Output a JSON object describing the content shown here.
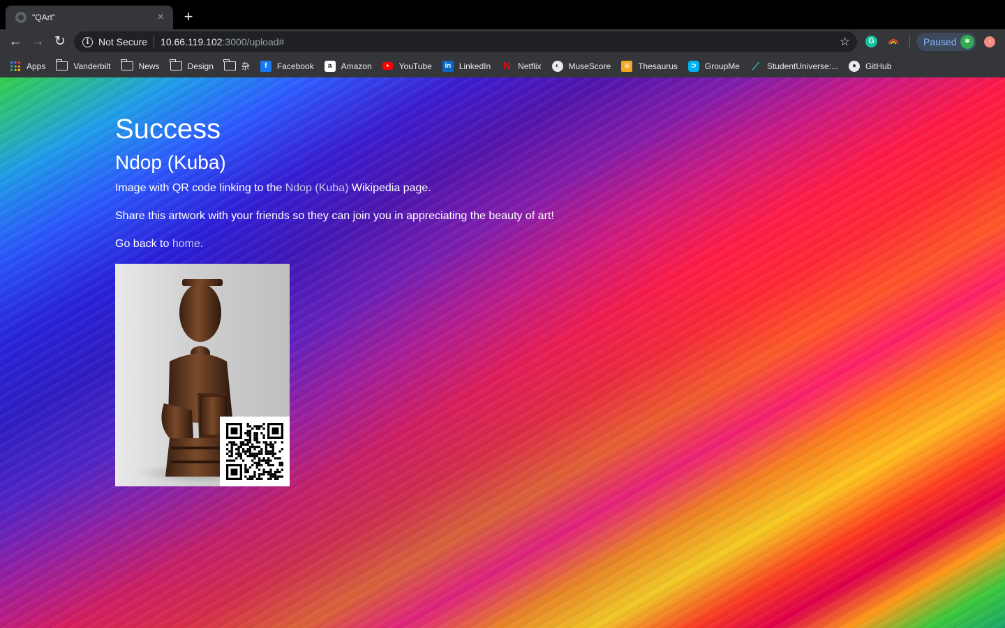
{
  "browser": {
    "tab": {
      "title": "\"QArt\"",
      "close_glyph": "×"
    },
    "new_tab_glyph": "+",
    "nav": {
      "back_glyph": "←",
      "forward_glyph": "→",
      "reload_glyph": "↻"
    },
    "omnibox": {
      "security_label": "Not Secure",
      "url_host": "10.66.119.102",
      "url_rest": ":3000/upload#"
    },
    "profile": {
      "label": "Paused"
    },
    "bookmarks": [
      {
        "label": "Apps",
        "icon": "apps-grid-icon"
      },
      {
        "label": "Vanderbilt",
        "icon": "folder-icon"
      },
      {
        "label": "News",
        "icon": "folder-icon"
      },
      {
        "label": "Design",
        "icon": "folder-icon"
      },
      {
        "label": "杂",
        "icon": "folder-icon"
      },
      {
        "label": "Facebook",
        "icon": "facebook-icon"
      },
      {
        "label": "Amazon",
        "icon": "amazon-icon"
      },
      {
        "label": "YouTube",
        "icon": "youtube-icon"
      },
      {
        "label": "LinkedIn",
        "icon": "linkedin-icon"
      },
      {
        "label": "Netflix",
        "icon": "netflix-icon"
      },
      {
        "label": "MuseScore",
        "icon": "musescore-icon"
      },
      {
        "label": "Thesaurus",
        "icon": "thesaurus-icon"
      },
      {
        "label": "GroupMe",
        "icon": "groupme-icon"
      },
      {
        "label": "StudentUniverse:...",
        "icon": "studentuniverse-icon"
      },
      {
        "label": "GitHub",
        "icon": "github-icon"
      }
    ]
  },
  "page": {
    "heading": "Success",
    "artwork_title": "Ndop (Kuba)",
    "caption_prefix": "Image with QR code linking to the ",
    "caption_link": "Ndop (Kuba)",
    "caption_suffix": " Wikipedia page.",
    "share_text": "Share this artwork with your friends so they can join you in appreciating the beauty of art!",
    "back_prefix": "Go back to ",
    "back_link": "home",
    "back_suffix": "."
  },
  "colors": {
    "link": "#c8c8e6",
    "text": "#ffffff",
    "toolbar": "#35363a",
    "tabstrip": "#000000"
  }
}
